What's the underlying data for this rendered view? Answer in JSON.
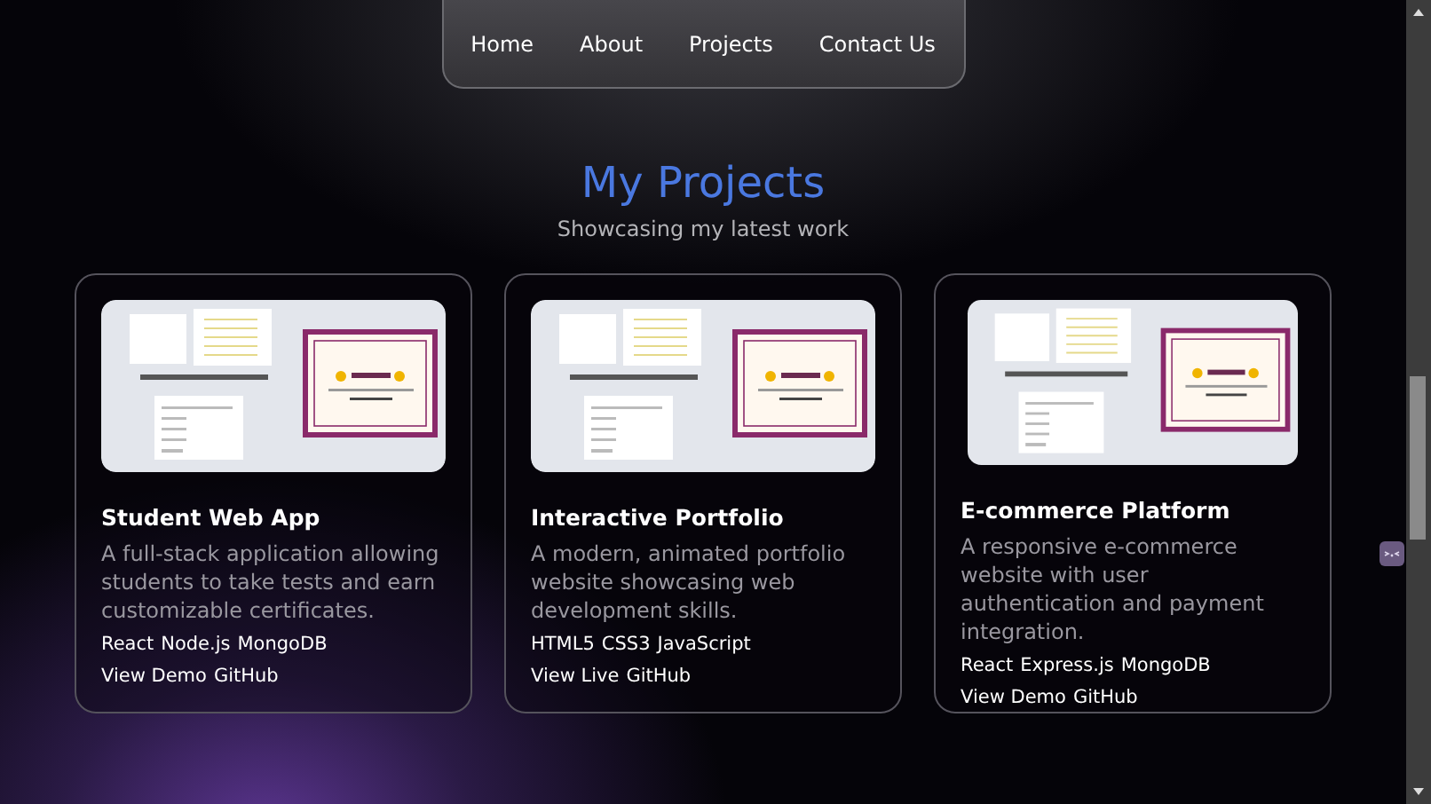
{
  "nav": {
    "links": [
      {
        "label": "Home"
      },
      {
        "label": "About"
      },
      {
        "label": "Projects"
      },
      {
        "label": "Contact Us"
      }
    ]
  },
  "section": {
    "title": "My Projects",
    "subtitle": "Showcasing my latest work"
  },
  "projects": [
    {
      "title": "Student Web App",
      "description": "A full-stack application allowing students to take tests and earn customizable certificates.",
      "tags": [
        "React",
        "Node.js",
        "MongoDB"
      ],
      "links": [
        "View Demo",
        "GitHub"
      ]
    },
    {
      "title": "Interactive Portfolio",
      "description": "A modern, animated portfolio website showcasing web development skills.",
      "tags": [
        "HTML5",
        "CSS3",
        "JavaScript"
      ],
      "links": [
        "View Live",
        "GitHub"
      ]
    },
    {
      "title": "E-commerce Platform",
      "description": "A responsive e-commerce website with user authentication and payment integration.",
      "tags": [
        "React",
        "Express.js",
        "MongoDB"
      ],
      "links": [
        "View Demo",
        "GitHub"
      ]
    }
  ]
}
